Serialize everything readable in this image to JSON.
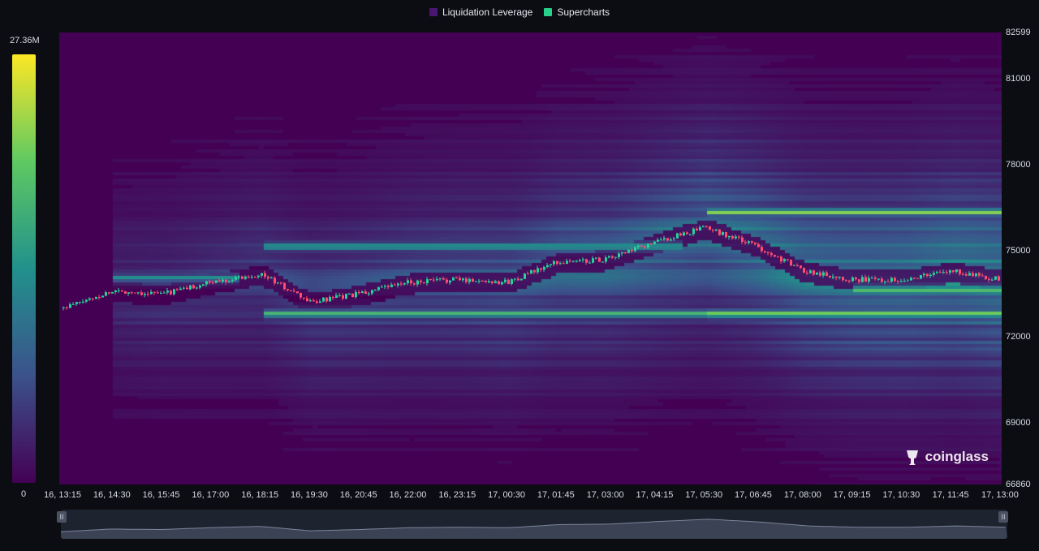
{
  "legend": {
    "items": [
      {
        "label": "Liquidation Leverage",
        "color": "#4a1670"
      },
      {
        "label": "Supercharts",
        "color": "#27d18a"
      }
    ]
  },
  "colorbar": {
    "max_label": "27.36M",
    "min_label": "0",
    "stops": [
      "#440154",
      "#3b528b",
      "#21918c",
      "#5ec962",
      "#fde725"
    ]
  },
  "watermark": {
    "text": "coinglass",
    "icon": "coinglass-logo-icon"
  },
  "navigator": {
    "left_handle": "II",
    "right_handle": "II"
  },
  "chart_data": {
    "type": "heatmap",
    "title": "",
    "ylim": [
      66860,
      82599
    ],
    "y_ticks": [
      "82599",
      "81000",
      "78000",
      "75000",
      "72000",
      "69000",
      "66860"
    ],
    "y_tick_values": [
      82599,
      81000,
      78000,
      75000,
      72000,
      69000,
      66860
    ],
    "x_ticks": [
      "16, 13:15",
      "16, 14:30",
      "16, 15:45",
      "16, 17:00",
      "16, 18:15",
      "16, 19:30",
      "16, 20:45",
      "16, 22:00",
      "16, 23:15",
      "17, 00:30",
      "17, 01:45",
      "17, 03:00",
      "17, 04:15",
      "17, 05:30",
      "17, 06:45",
      "17, 08:00",
      "17, 09:15",
      "17, 10:30",
      "17, 11:45",
      "17, 13:00"
    ],
    "liquidation_bands": [
      {
        "price": 72850,
        "start": "16, 18:15",
        "end": "17, 13:00",
        "level": 0.85
      },
      {
        "price": 72850,
        "start": "17, 05:30",
        "end": "17, 13:00",
        "level": 1.0
      },
      {
        "price": 76400,
        "start": "17, 05:30",
        "end": "17, 13:00",
        "level": 0.95
      },
      {
        "price": 75200,
        "start": "16, 18:15",
        "end": "17, 04:15",
        "level": 0.75
      },
      {
        "price": 74100,
        "start": "16, 14:30",
        "end": "16, 17:00",
        "level": 0.6
      },
      {
        "price": 73700,
        "start": "17, 09:15",
        "end": "17, 13:00",
        "level": 0.9
      }
    ],
    "price_series": [
      {
        "t": "16, 13:15",
        "close": 73000
      },
      {
        "t": "16, 14:30",
        "close": 73600
      },
      {
        "t": "16, 15:45",
        "close": 73500
      },
      {
        "t": "16, 17:00",
        "close": 73900
      },
      {
        "t": "16, 18:15",
        "close": 74200
      },
      {
        "t": "16, 19:30",
        "close": 73200
      },
      {
        "t": "16, 20:45",
        "close": 73500
      },
      {
        "t": "16, 22:00",
        "close": 73900
      },
      {
        "t": "16, 23:15",
        "close": 74000
      },
      {
        "t": "17, 00:30",
        "close": 73900
      },
      {
        "t": "17, 01:45",
        "close": 74600
      },
      {
        "t": "17, 03:00",
        "close": 74700
      },
      {
        "t": "17, 04:15",
        "close": 75300
      },
      {
        "t": "17, 05:30",
        "close": 75800
      },
      {
        "t": "17, 06:45",
        "close": 75200
      },
      {
        "t": "17, 08:00",
        "close": 74300
      },
      {
        "t": "17, 09:15",
        "close": 74000
      },
      {
        "t": "17, 10:30",
        "close": 74000
      },
      {
        "t": "17, 11:45",
        "close": 74300
      },
      {
        "t": "17, 13:00",
        "close": 74000
      }
    ],
    "grid": false,
    "legend_position": "top-center"
  }
}
